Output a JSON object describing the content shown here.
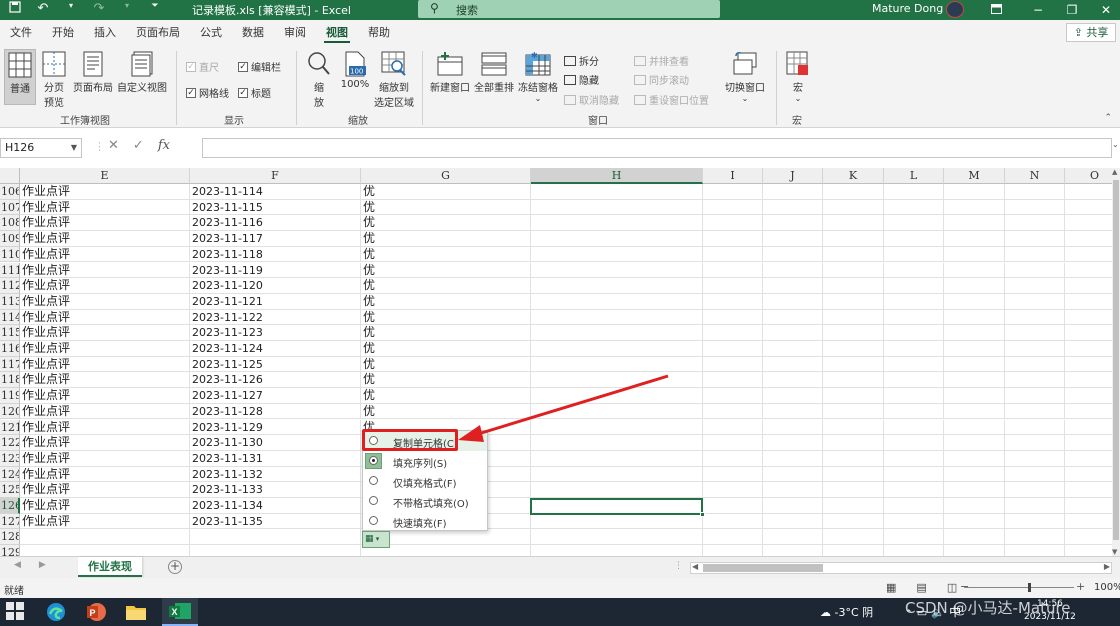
{
  "titlebar": {
    "doc_title": "记录模板.xls  [兼容模式]  -  Excel",
    "search_placeholder": "搜索",
    "user": "Mature Dong",
    "undo_icon": "↶",
    "redo_icon": "↷",
    "save_icon": "save-icon",
    "minimize": "−",
    "restore": "❐",
    "close": "✕",
    "ribbon_display": "ribbon-display-icon"
  },
  "tabs": [
    "文件",
    "开始",
    "插入",
    "页面布局",
    "公式",
    "数据",
    "审阅",
    "视图",
    "帮助"
  ],
  "active_tab": "视图",
  "share_label": "共享",
  "ribbon": {
    "workbook_views": {
      "label": "工作簿视图",
      "normal": "普通",
      "page_break_1": "分页",
      "page_break_2": "预览",
      "page_layout": "页面布局",
      "custom_view": "自定义视图"
    },
    "show": {
      "label": "显示",
      "ruler": "直尺",
      "formula_bar": "编辑栏",
      "gridlines": "网格线",
      "headings": "标题"
    },
    "zoom": {
      "label": "缩放",
      "zoom_1": "缩",
      "zoom_2": "放",
      "zoom_100": "100%",
      "zoom_to_selection_1": "缩放到",
      "zoom_to_selection_2": "选定区域",
      "badge": "100"
    },
    "window": {
      "label": "窗口",
      "new_window": "新建窗口",
      "arrange_all": "全部重排",
      "freeze_panes": "冻结窗格",
      "split": "拆分",
      "hide": "隐藏",
      "unhide": "取消隐藏",
      "view_side_by_side": "并排查看",
      "sync_scroll": "同步滚动",
      "reset_position": "重设窗口位置",
      "switch_windows": "切换窗口"
    },
    "macros": {
      "label": "宏",
      "macros": "宏"
    }
  },
  "formula_bar": {
    "name_box": "H126",
    "cancel": "✕",
    "enter": "✓",
    "fx": "fx",
    "value": ""
  },
  "columns": [
    "E",
    "F",
    "G",
    "H",
    "I",
    "J",
    "K",
    "L",
    "M",
    "N",
    "O"
  ],
  "active_column": "H",
  "rows": [
    {
      "n": "106",
      "e": "作业点评",
      "f": "2023-11-114",
      "g": "优"
    },
    {
      "n": "107",
      "e": "作业点评",
      "f": "2023-11-115",
      "g": "优"
    },
    {
      "n": "108",
      "e": "作业点评",
      "f": "2023-11-116",
      "g": "优"
    },
    {
      "n": "109",
      "e": "作业点评",
      "f": "2023-11-117",
      "g": "优"
    },
    {
      "n": "110",
      "e": "作业点评",
      "f": "2023-11-118",
      "g": "优"
    },
    {
      "n": "111",
      "e": "作业点评",
      "f": "2023-11-119",
      "g": "优"
    },
    {
      "n": "112",
      "e": "作业点评",
      "f": "2023-11-120",
      "g": "优"
    },
    {
      "n": "113",
      "e": "作业点评",
      "f": "2023-11-121",
      "g": "优"
    },
    {
      "n": "114",
      "e": "作业点评",
      "f": "2023-11-122",
      "g": "优"
    },
    {
      "n": "115",
      "e": "作业点评",
      "f": "2023-11-123",
      "g": "优"
    },
    {
      "n": "116",
      "e": "作业点评",
      "f": "2023-11-124",
      "g": "优"
    },
    {
      "n": "117",
      "e": "作业点评",
      "f": "2023-11-125",
      "g": "优"
    },
    {
      "n": "118",
      "e": "作业点评",
      "f": "2023-11-126",
      "g": "优"
    },
    {
      "n": "119",
      "e": "作业点评",
      "f": "2023-11-127",
      "g": "优"
    },
    {
      "n": "120",
      "e": "作业点评",
      "f": "2023-11-128",
      "g": "优"
    },
    {
      "n": "121",
      "e": "作业点评",
      "f": "2023-11-129",
      "g": "优"
    },
    {
      "n": "122",
      "e": "作业点评",
      "f": "2023-11-130",
      "g": ""
    },
    {
      "n": "123",
      "e": "作业点评",
      "f": "2023-11-131",
      "g": ""
    },
    {
      "n": "124",
      "e": "作业点评",
      "f": "2023-11-132",
      "g": ""
    },
    {
      "n": "125",
      "e": "作业点评",
      "f": "2023-11-133",
      "g": ""
    },
    {
      "n": "126",
      "e": "作业点评",
      "f": "2023-11-134",
      "g": ""
    },
    {
      "n": "127",
      "e": "作业点评",
      "f": "2023-11-135",
      "g": ""
    },
    {
      "n": "128",
      "e": "",
      "f": "",
      "g": ""
    },
    {
      "n": "129",
      "e": "",
      "f": "",
      "g": ""
    }
  ],
  "active_row": "126",
  "autofill_menu": {
    "items": [
      {
        "label": "复制单元格(C)",
        "selected": false,
        "highlighted": true
      },
      {
        "label": "填充序列(S)",
        "selected": true,
        "highlighted": false
      },
      {
        "label": "仅填充格式(F)",
        "selected": false,
        "highlighted": false
      },
      {
        "label": "不带格式填充(O)",
        "selected": false,
        "highlighted": false
      },
      {
        "label": "快速填充(F)",
        "selected": false,
        "highlighted": false
      }
    ],
    "button_icon": "auto-fill-options-icon"
  },
  "sheet_tabs": [
    "作业表现"
  ],
  "add_sheet": "+",
  "status": {
    "ready": "就绪",
    "zoom_minus": "−",
    "zoom_plus": "+",
    "zoom": "100%"
  },
  "taskbar": {
    "weather": "-3°C  阴",
    "time": "14:56",
    "date": "2023/11/12",
    "input_method": "中"
  },
  "watermark": "CSDN @小马达-Mature",
  "colors": {
    "excel_green": "#217346",
    "annotation_red": "#e02020"
  }
}
